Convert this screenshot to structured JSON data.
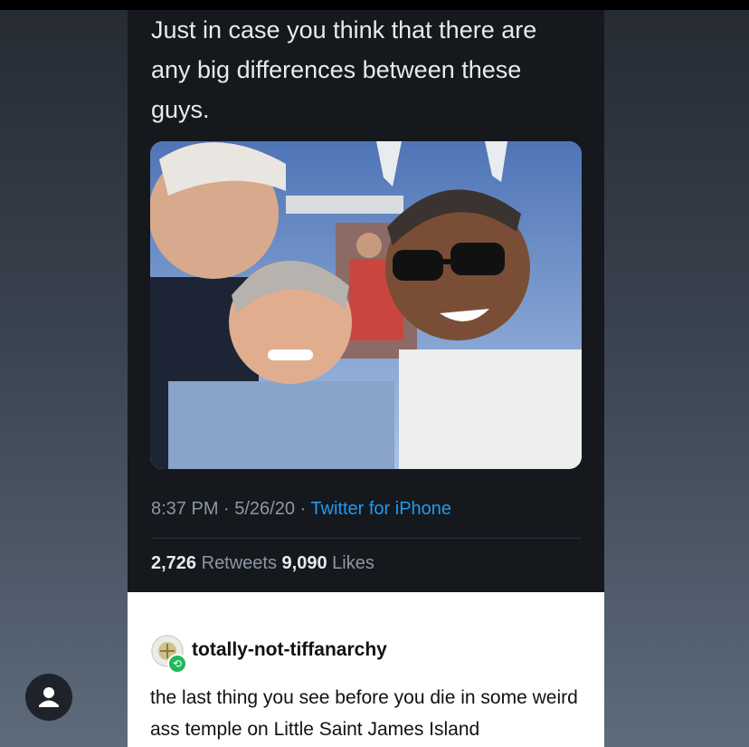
{
  "tweet": {
    "text": "Just in case you think that there are any big differences between these guys.",
    "photo_icon": "photo",
    "timestamp": "8:37 PM · 5/26/20 · ",
    "source": "Twitter for iPhone",
    "retweets_count": "2,726",
    "retweets_label": " Retweets ",
    "likes_count": "9,090",
    "likes_label": " Likes"
  },
  "reblog": {
    "username": "totally-not-tiffanarchy",
    "body": "the last thing you see before you die in some weird ass temple on Little Saint James Island",
    "avatar_icon": "user-avatar",
    "badge_icon": "reblog-icon"
  },
  "fab_icon": "user-icon",
  "colors": {
    "tweet_background": "#15181d",
    "link": "#1d9bf0",
    "muted": "#8b98a5",
    "reblog_badge": "#20b85a"
  }
}
